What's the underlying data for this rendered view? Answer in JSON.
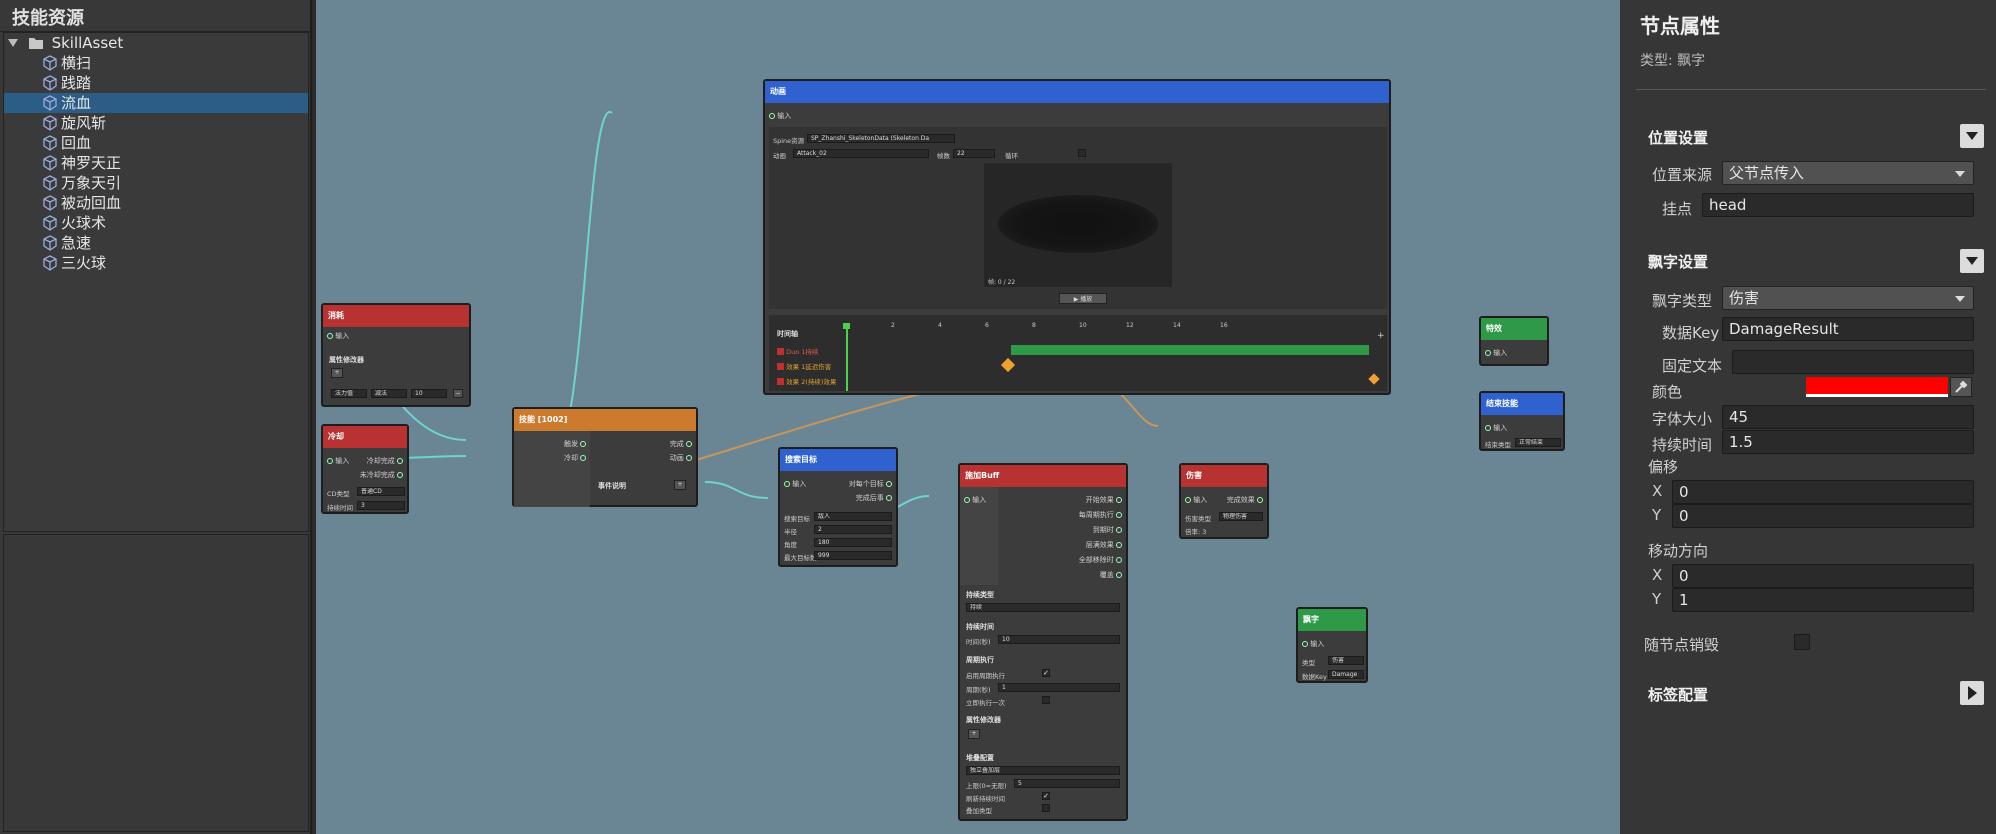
{
  "left": {
    "title": "技能资源",
    "root": "SkillAsset",
    "items": [
      "横扫",
      "践踏",
      "流血",
      "旋风斩",
      "回血",
      "神罗天正",
      "万象天引",
      "被动回血",
      "火球术",
      "急速",
      "三火球"
    ],
    "selected": "流血"
  },
  "nodes": {
    "consume": {
      "title": "消耗",
      "input": "输入",
      "section": "属性修改器",
      "add": "+",
      "f1": "法力值",
      "f2": "减法",
      "f3": "10",
      "minus": "−"
    },
    "cooldown": {
      "title": "冷却",
      "input": "输入",
      "out1": "冷却完成",
      "out2": "未冷却完成",
      "type_label": "CD类型",
      "type_val": "普通CD",
      "dur_label": "持续时间",
      "dur_val": "3"
    },
    "skill": {
      "title": "技能 [1002]",
      "p1": "触发",
      "p2": "冷却",
      "o1": "完成",
      "o2": "动画",
      "event": "事件说明"
    },
    "anim": {
      "title": "动画",
      "input": "输入",
      "spine_label": "Spine资源",
      "spine_val": "SP_Zhanshi_SkeletonData (Skeleton Da",
      "anim_label": "动画",
      "anim_val": "Attack_02",
      "speed_label": "帧数",
      "speed_val": "22",
      "loop_label": "循环",
      "frame": "帧: 0 / 22",
      "play": "▶ 播放",
      "timeline_label": "时间轴",
      "ticks": [
        "2",
        "4",
        "6",
        "8",
        "10",
        "12",
        "14",
        "16"
      ],
      "tracks": [
        "Duo 1持续",
        "效果 1延迟伤害",
        "效果 2(持续)效果"
      ]
    },
    "target": {
      "title": "搜索目标",
      "input": "输入",
      "o1": "对每个目标",
      "o2": "完成后事",
      "l1": "搜索目标",
      "v1": "敌人",
      "l2": "半径",
      "v2": "2",
      "l3": "角度",
      "v3": "180",
      "l4": "最大目标数",
      "v4": "999"
    },
    "buff": {
      "title": "施加Buff",
      "input": "输入",
      "outs": [
        "开始效果",
        "每周期执行",
        "到期时",
        "层满效果",
        "全部移除时",
        "覆盖"
      ],
      "s1": "持续类型",
      "s1v": "持续",
      "s2": "持续时间",
      "s2l": "时间(秒)",
      "s2v": "10",
      "s3": "周期执行",
      "s3l": "启用周期执行",
      "s3l2": "周期(秒)",
      "s3v": "1",
      "s3l3": "立即执行一次",
      "s4": "属性修改器",
      "s4add": "+",
      "s5": "堆叠配置",
      "s5v": "独立叠加层",
      "s5l": "上限(0=无限)",
      "s5lv": "5",
      "s5l2": "刷新持续时间",
      "s5l3": "叠加类型"
    },
    "damage": {
      "title": "伤害",
      "input": "输入",
      "out": "完成效果",
      "l1": "伤害类型",
      "v1": "物理伤害",
      "l2": "倍率",
      "v2": "3"
    },
    "fx": {
      "title": "特效",
      "input": "输入"
    },
    "endskill": {
      "title": "结束技能",
      "input": "输入",
      "l": "结束类型",
      "v": "正常结束"
    },
    "float": {
      "title": "飘字",
      "input": "输入",
      "l1": "类型",
      "v1": "伤害",
      "l2": "数据Key",
      "v2": "Damage"
    }
  },
  "inspector": {
    "title": "节点属性",
    "type": "类型: 飘字",
    "pos_section": "位置设置",
    "pos_src_label": "位置来源",
    "pos_src_val": "父节点传入",
    "mount_label": "挂点",
    "mount_val": "head",
    "float_section": "飘字设置",
    "ftype_label": "飘字类型",
    "ftype_val": "伤害",
    "key_label": "数据Key",
    "key_val": "DamageResult",
    "text_label": "固定文本",
    "text_val": "",
    "color_label": "颜色",
    "color": "#ff0000",
    "size_label": "字体大小",
    "size_val": "45",
    "dur_label": "持续时间",
    "dur_val": "1.5",
    "offset_label": "偏移",
    "ox_label": "X",
    "ox_val": "0",
    "oy_label": "Y",
    "oy_val": "0",
    "dir_label": "移动方向",
    "dx_label": "X",
    "dx_val": "0",
    "dy_label": "Y",
    "dy_val": "1",
    "destroy_label": "随节点销毁",
    "tag_section": "标签配置"
  },
  "colors": {
    "canvas": "#6a8594",
    "red": "#b83232",
    "blue": "#2f62cf",
    "green": "#2e9a48",
    "orange": "#cc7a2e",
    "wire": "#6fd3cf",
    "wire2": "#c9955a"
  }
}
